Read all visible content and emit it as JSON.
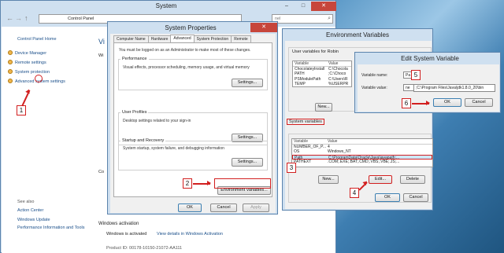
{
  "system": {
    "title": "System",
    "breadcrumb_root": "Control Panel",
    "search_placeholder": "nel",
    "nav": {
      "home": "Control Panel Home",
      "items": [
        "Device Manager",
        "Remote settings",
        "System protection",
        "Advanced system settings"
      ]
    },
    "main_heading": "Vi",
    "main_labels": [
      "Wi",
      "Co"
    ],
    "see_also_title": "See also",
    "see_also": [
      "Action Center",
      "Windows Update",
      "Performance Information and Tools"
    ],
    "windows_activation_title": "Windows activation",
    "activation_status": "Windows is activated",
    "activation_link": "View details in Windows Activation",
    "product_id": "Product ID: 00178-10150-21072-AA111"
  },
  "sysprops": {
    "title": "System Properties",
    "tabs": [
      "Computer Name",
      "Hardware",
      "Advanced",
      "System Protection",
      "Remote"
    ],
    "admin_note": "You must be logged on as an Administrator to make most of these changes.",
    "performance": {
      "label": "Performance",
      "desc": "Visual effects, processor scheduling, memory usage, and virtual memory",
      "button": "Settings..."
    },
    "profiles": {
      "label": "User Profiles",
      "desc": "Desktop settings related to your sign-in",
      "button": "Settings..."
    },
    "startup": {
      "label": "Startup and Recovery",
      "desc": "System startup, system failure, and debugging information",
      "button": "Settings..."
    },
    "env_button": "Environment Variables...",
    "ok": "OK",
    "cancel": "Cancel",
    "apply": "Apply"
  },
  "envvars": {
    "title": "Environment Variables",
    "user_label": "User variables for Robin",
    "col_variable": "Variable",
    "col_value": "Value",
    "user_rows": [
      [
        "ChocolateyInstall",
        "C:\\Chocola"
      ],
      [
        "PATH",
        ";C:\\Choco"
      ],
      [
        "PSModulePath",
        "C:\\Users\\R"
      ],
      [
        "TEMP",
        "%USERPR"
      ]
    ],
    "user_new": "New...",
    "system_label": "System variables",
    "system_rows": [
      [
        "NUMBER_OF_P...",
        "4"
      ],
      [
        "OS",
        "Windows_NT"
      ],
      [
        "Path",
        "C:\\ProgramData\\Oracle\\Java\\javapath;..."
      ],
      [
        "PATHEXT",
        ".COM;.EXE;.BAT;.CMD;.VBS;.VBE;.JS;..."
      ]
    ],
    "new": "New...",
    "edit": "Edit...",
    "delete": "Delete",
    "ok": "OK",
    "cancel": "Cancel"
  },
  "editvar": {
    "title": "Edit System Variable",
    "name_label": "Variable name:",
    "value_label": "Variable value:",
    "name_value": "Pa",
    "value_prefix": "ne",
    "value_value": ";C:\\Program Files\\Java\\jdk1.8.0_20\\bin",
    "ok": "OK",
    "cancel": "Cancel"
  },
  "callouts": [
    "1",
    "2",
    "3",
    "4",
    "5",
    "6"
  ],
  "colors": {
    "annotation": "#d21f1f",
    "link": "#1a4f8a",
    "frame": "#cfe0f0"
  }
}
